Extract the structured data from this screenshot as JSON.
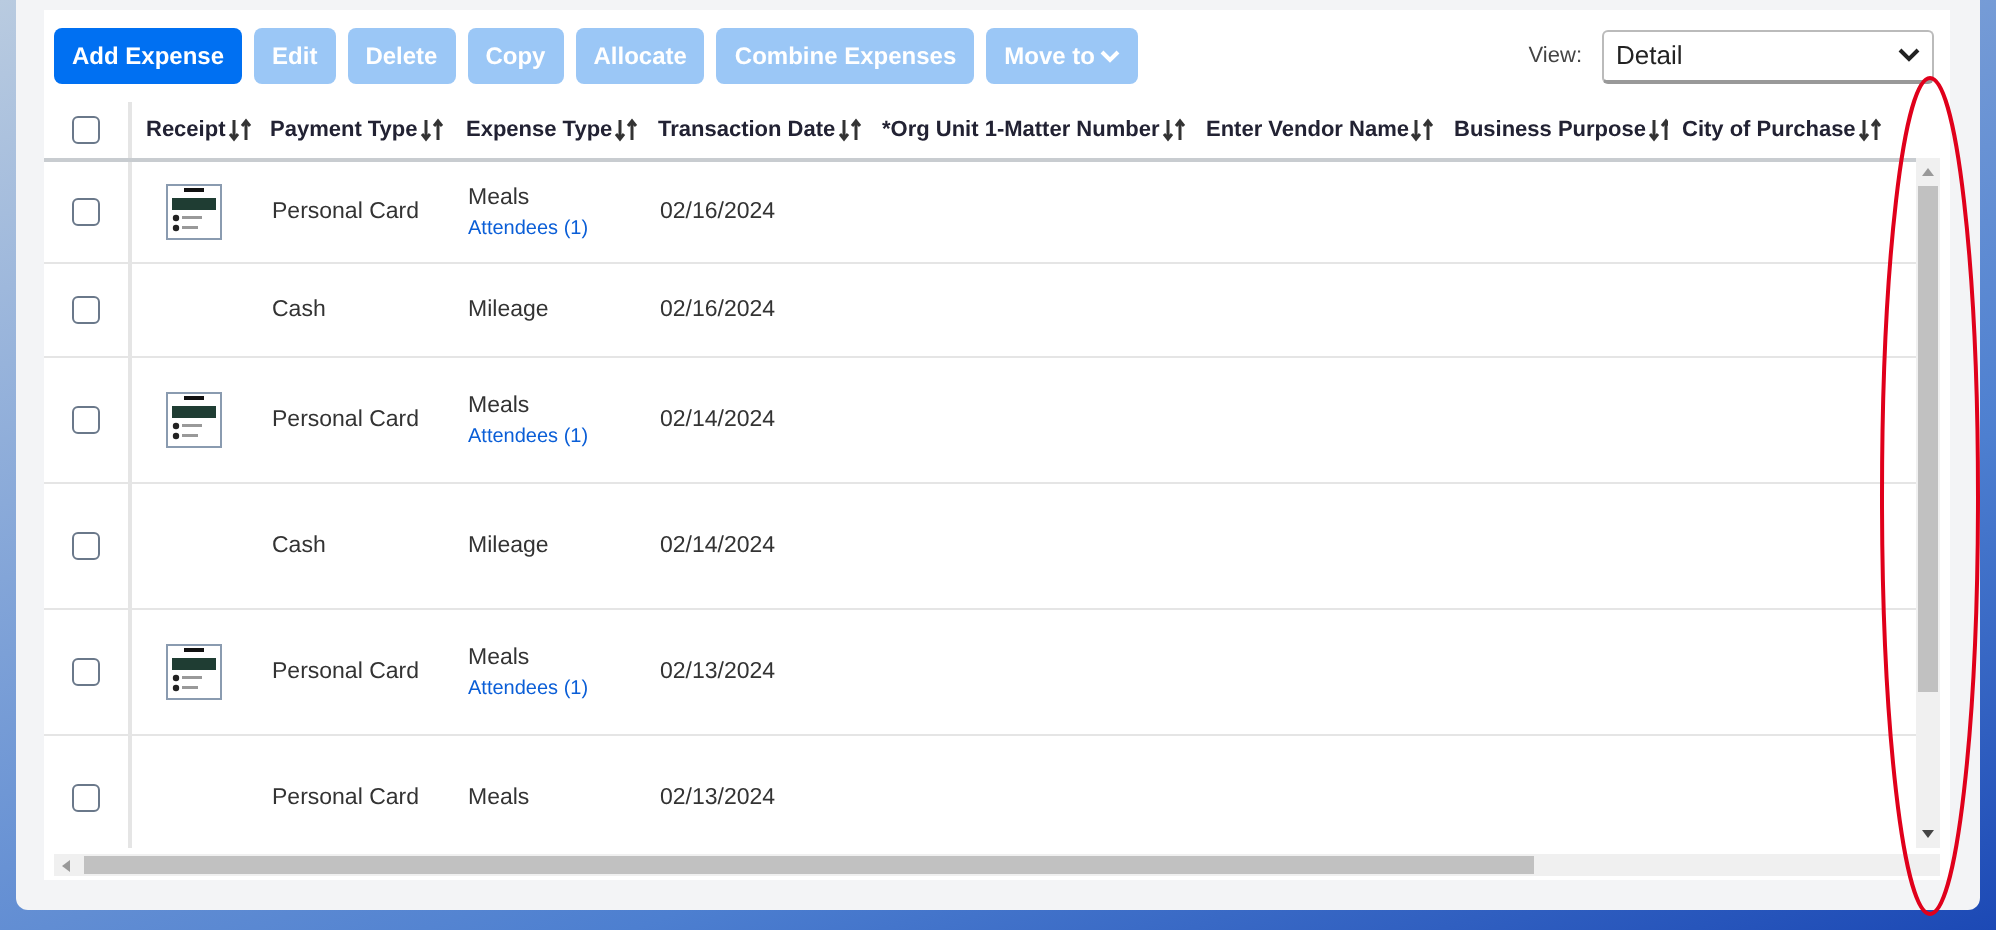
{
  "toolbar": {
    "buttons": [
      {
        "label": "Add Expense",
        "kind": "primary",
        "disabled": false
      },
      {
        "label": "Edit",
        "kind": "plain",
        "disabled": true
      },
      {
        "label": "Delete",
        "kind": "plain",
        "disabled": true
      },
      {
        "label": "Copy",
        "kind": "plain",
        "disabled": true
      },
      {
        "label": "Allocate",
        "kind": "plain",
        "disabled": true
      },
      {
        "label": "Combine Expenses",
        "kind": "plain",
        "disabled": true
      },
      {
        "label": "Move to",
        "kind": "menu",
        "disabled": true
      }
    ],
    "view": {
      "label": "View:",
      "value": "Detail"
    }
  },
  "table": {
    "select_all": {
      "checked": false
    },
    "columns": [
      "Receipt",
      "Payment Type",
      "Expense Type",
      "Transaction Date",
      "*Org Unit 1-Matter Number",
      "Enter Vendor Name",
      "Business Purpose",
      "City of Purchase"
    ],
    "rows": [
      {
        "checked": false,
        "receipt": true,
        "payment_type": "Personal Card",
        "expense_type": "Meals",
        "attendees": "Attendees (1)",
        "date": "02/16/2024"
      },
      {
        "checked": false,
        "receipt": false,
        "payment_type": "Cash",
        "expense_type": "Mileage",
        "date": "02/16/2024"
      },
      {
        "checked": false,
        "receipt": true,
        "payment_type": "Personal Card",
        "expense_type": "Meals",
        "attendees": "Attendees (1)",
        "date": "02/14/2024"
      },
      {
        "checked": false,
        "receipt": false,
        "payment_type": "Cash",
        "expense_type": "Mileage",
        "date": "02/14/2024"
      },
      {
        "checked": false,
        "receipt": true,
        "payment_type": "Personal Card",
        "expense_type": "Meals",
        "attendees": "Attendees (1)",
        "date": "02/13/2024"
      },
      {
        "checked": false,
        "receipt": false,
        "payment_type": "Personal Card",
        "expense_type": "Meals",
        "date": "02/13/2024"
      }
    ]
  }
}
